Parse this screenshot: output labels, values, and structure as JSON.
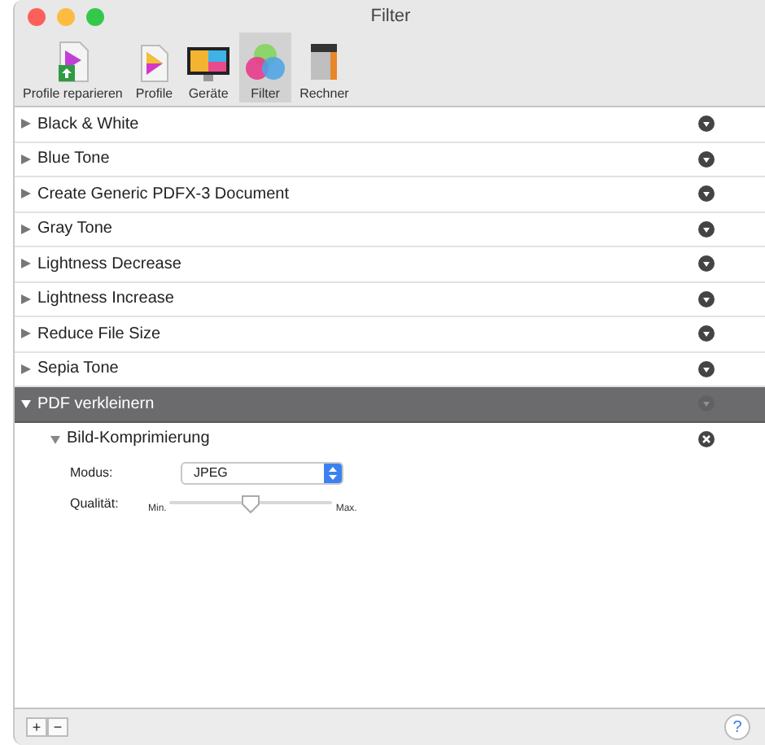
{
  "window": {
    "title": "Filter"
  },
  "toolbar": [
    {
      "label": "Profile reparieren",
      "kind": "repair",
      "selected": false
    },
    {
      "label": "Profile",
      "kind": "profile",
      "selected": false
    },
    {
      "label": "Geräte",
      "kind": "display",
      "selected": false
    },
    {
      "label": "Filter",
      "kind": "filter",
      "selected": true
    },
    {
      "label": "Rechner",
      "kind": "calc",
      "selected": false
    }
  ],
  "filters": [
    {
      "label": "Black & White",
      "expanded": false,
      "selected": false
    },
    {
      "label": "Blue Tone",
      "expanded": false,
      "selected": false
    },
    {
      "label": "Create Generic PDFX-3 Document",
      "expanded": false,
      "selected": false
    },
    {
      "label": "Gray Tone",
      "expanded": false,
      "selected": false
    },
    {
      "label": "Lightness Decrease",
      "expanded": false,
      "selected": false
    },
    {
      "label": "Lightness Increase",
      "expanded": false,
      "selected": false
    },
    {
      "label": "Reduce File Size",
      "expanded": false,
      "selected": false
    },
    {
      "label": "Sepia Tone",
      "expanded": false,
      "selected": false
    },
    {
      "label": "PDF verkleinern",
      "expanded": true,
      "selected": true,
      "children": [
        {
          "label": "Bild-Komprimierung",
          "expanded": true,
          "mode_label": "Modus:",
          "mode_value": "JPEG",
          "quality_label": "Qualität:",
          "min_label": "Min.",
          "max_label": "Max.",
          "level": 0.5
        }
      ]
    }
  ],
  "bottom_bar": {
    "add": "+",
    "remove": "−",
    "help": "?"
  }
}
